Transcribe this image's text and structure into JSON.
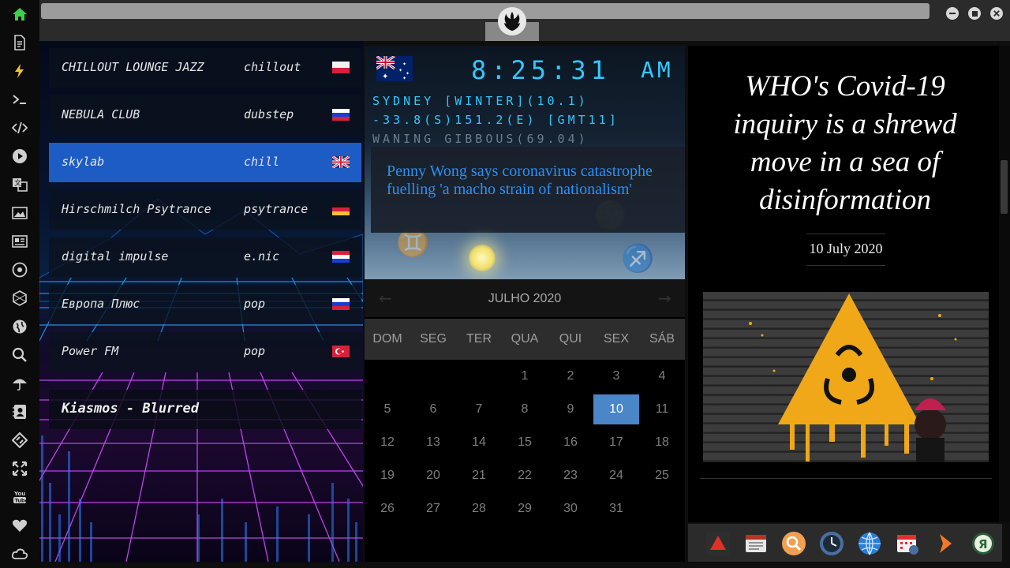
{
  "sidebar": {
    "icons": [
      "home-icon",
      "document-icon",
      "bolt-icon",
      "terminal-icon",
      "code-icon",
      "play-icon",
      "translate-icon",
      "image-icon",
      "news-icon",
      "rebel-icon",
      "hexagon-icon",
      "globe-icon",
      "search-icon",
      "umbrella-icon",
      "contacts-icon",
      "tag-icon",
      "fullscreen-icon",
      "youtube-icon",
      "heart-icon",
      "cloud-icon"
    ],
    "youtube_label": "You\nTube"
  },
  "radio": {
    "stations": [
      {
        "name": "CHILLOUT LOUNGE JAZZ",
        "genre": "chillout",
        "flag": "poland"
      },
      {
        "name": "NEBULA CLUB",
        "genre": "dubstep",
        "flag": "russia"
      },
      {
        "name": "skylab",
        "genre": "chill",
        "flag": "uk",
        "active": true
      },
      {
        "name": "Hirschmilch Psytrance",
        "genre": "psytrance",
        "flag": "germany"
      },
      {
        "name": "digital impulse",
        "genre": "e.nic",
        "flag": "croatia"
      },
      {
        "name": "Европа Плюс",
        "genre": "pop",
        "flag": "russia"
      },
      {
        "name": "Power FM",
        "genre": "pop",
        "flag": "turkey"
      }
    ],
    "now_playing": "Kiasmos - Blurred"
  },
  "clock": {
    "time": "8:25:31",
    "ampm": "AM",
    "line1": "SYDNEY [WINTER](10.1)",
    "line2": "-33.8(S)151.2(E) [GMT11]",
    "line3": "WANING GIBBOUS(69.04)",
    "headline": "Penny Wong says coronavirus catastrophe fuelling 'a macho strain of nationalism'"
  },
  "calendar": {
    "month": "JULHO 2020",
    "weekdays": [
      "DOM",
      "SEG",
      "TER",
      "QUA",
      "QUI",
      "SEX",
      "SÁB"
    ],
    "today": 10,
    "first_weekday_index": 3,
    "days_in_month": 31
  },
  "article": {
    "title": "WHO's Covid-19 inquiry is a shrewd move in a sea of disinformation",
    "date": "10 July 2020"
  },
  "dock": {
    "apps": [
      "anydesk-icon",
      "schedule-icon",
      "search-app-icon",
      "clock-app-icon",
      "globe-app-icon",
      "calendar-app-icon",
      "arrow-app-icon",
      "yandex-icon"
    ]
  },
  "colors": {
    "accent_blue": "#1d5cc4",
    "clock_cyan": "#33c7ff",
    "headline_blue": "#2f8ff0",
    "today_blue": "#4a86c8"
  }
}
